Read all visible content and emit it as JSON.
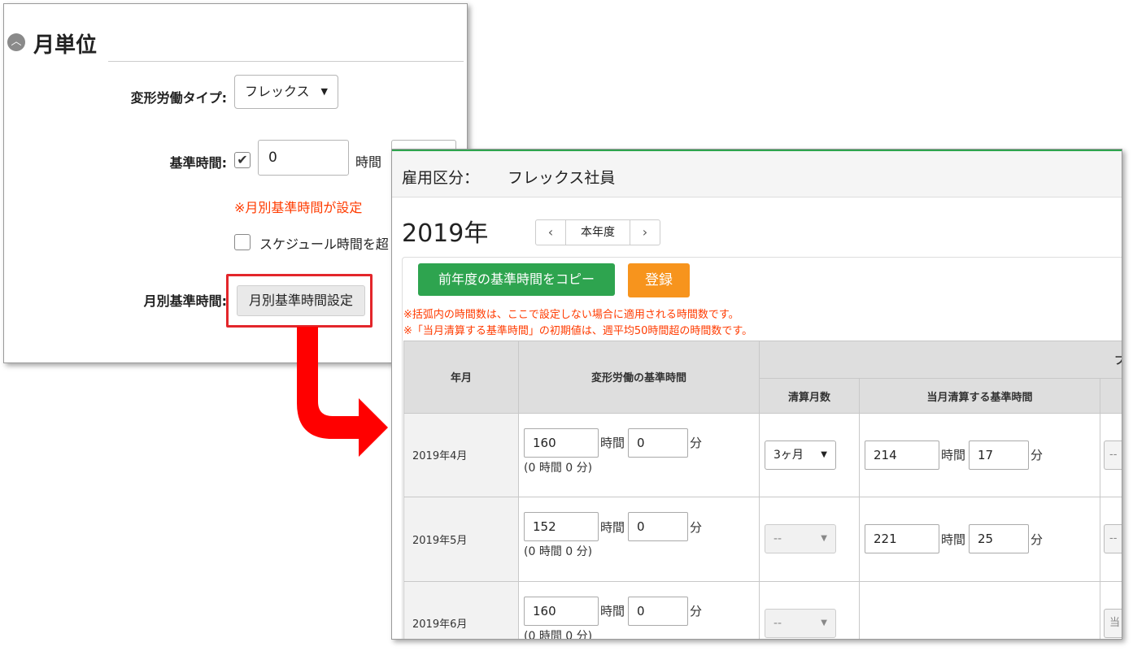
{
  "monthly_panel": {
    "section_title": "月単位",
    "work_type_label": "変形労働タイプ:",
    "work_type_value": "フレックス",
    "base_time_label": "基準時間:",
    "base_time_value": "0",
    "base_time_unit": "時間",
    "warning_text": "※月別基準時間が設定",
    "schedule_checkbox_label": "スケジュール時間を超",
    "monthly_base_label": "月別基準時間:",
    "monthly_base_button": "月別基準時間設定"
  },
  "settings_panel": {
    "employment_label": "雇用区分：",
    "employment_value": "フレックス社員",
    "year": "2019年",
    "nav_current": "本年度",
    "copy_button": "前年度の基準時間をコピー",
    "register_button": "登録",
    "notes": [
      "※括弧内の時間数は、ここで設定しない場合に適用される時間数です。",
      "※「当月清算する基準時間」の初期値は、週平均50時間超の時間数です。"
    ],
    "table": {
      "header_group": "フレ",
      "col_year_month": "年月",
      "col_base_time": "変形労働の基準時間",
      "col_settle_months": "清算月数",
      "col_settle_base": "当月清算する基準時間",
      "hour_unit": "時間",
      "minute_unit": "分",
      "rows": [
        {
          "month": "2019年4月",
          "hours": "160",
          "minutes": "0",
          "default": "(0 時間 0 分)",
          "settle_months": "3ヶ月",
          "settle_enabled": "true",
          "settle_hours": "214",
          "settle_minutes": "17",
          "stub": "--"
        },
        {
          "month": "2019年5月",
          "hours": "152",
          "minutes": "0",
          "default": "(0 時間 0 分)",
          "settle_months": "--",
          "settle_enabled": "false",
          "settle_hours": "221",
          "settle_minutes": "25",
          "stub": "--"
        },
        {
          "month": "2019年6月",
          "hours": "160",
          "minutes": "0",
          "default": "(0 時間 0 分)",
          "settle_months": "--",
          "settle_enabled": "false",
          "settle_hours": "",
          "settle_minutes": "",
          "stub": "当"
        }
      ]
    }
  },
  "colors": {
    "accent_green": "#2ea44f",
    "accent_orange": "#f7941d",
    "warning_red": "#ff3b00",
    "highlight_red": "#e3262b"
  }
}
